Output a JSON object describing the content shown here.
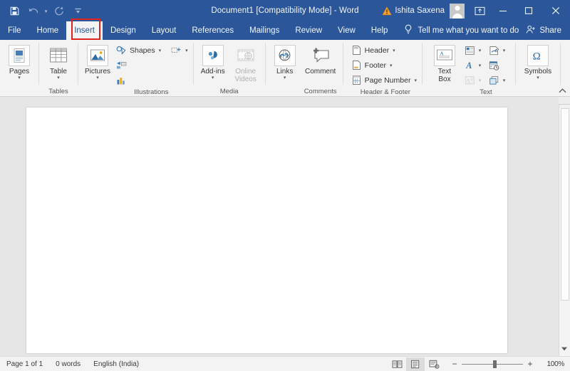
{
  "window": {
    "title": "Document1 [Compatibility Mode]  -  Word",
    "account_name": "Ishita Saxena",
    "quick_access": [
      {
        "name": "save-button",
        "glyph": "save-icon"
      },
      {
        "name": "undo-button",
        "glyph": "undo-icon"
      },
      {
        "name": "redo-button",
        "glyph": "redo-icon"
      },
      {
        "name": "customize-quick-access-button",
        "glyph": "chevron-down-icon"
      }
    ],
    "controls": {
      "ribbon_display_options": "ribbon-display-options-icon",
      "minimize": "minimize-icon",
      "maximize": "maximize-icon",
      "close": "close-icon",
      "warning": "warning-icon"
    }
  },
  "tabs": {
    "items": [
      {
        "label": "File",
        "active": false
      },
      {
        "label": "Home",
        "active": false
      },
      {
        "label": "Insert",
        "active": true
      },
      {
        "label": "Design",
        "active": false
      },
      {
        "label": "Layout",
        "active": false
      },
      {
        "label": "References",
        "active": false
      },
      {
        "label": "Mailings",
        "active": false
      },
      {
        "label": "Review",
        "active": false
      },
      {
        "label": "View",
        "active": false
      },
      {
        "label": "Help",
        "active": false
      }
    ],
    "tell_me": "Tell me what you want to do",
    "share": "Share",
    "highlight_color": "#e0231d",
    "accent_color": "#2b579a"
  },
  "ribbon": {
    "groups": [
      {
        "label": "",
        "big_buttons": [
          {
            "label": "Pages",
            "icon": "pages-icon",
            "dropdown": true,
            "disabled": false
          }
        ]
      },
      {
        "label": "Tables",
        "big_buttons": [
          {
            "label": "Table",
            "icon": "table-icon",
            "dropdown": true,
            "disabled": false
          }
        ]
      },
      {
        "label": "Illustrations",
        "big_buttons": [
          {
            "label": "Pictures",
            "icon": "pictures-icon",
            "dropdown": true,
            "disabled": false
          }
        ],
        "small_buttons": [
          {
            "label": "Shapes",
            "icon": "shapes-icon",
            "dropdown": true,
            "disabled": false
          },
          {
            "label": "",
            "icon": "smartart-icon",
            "dropdown": false,
            "disabled": false
          },
          {
            "label": "",
            "icon": "chart-icon",
            "dropdown": false,
            "disabled": false
          }
        ],
        "extra_buttons": [
          {
            "label": "",
            "icon": "screenshot-icon",
            "dropdown": true,
            "disabled": false
          }
        ]
      },
      {
        "label": "Media",
        "big_buttons": [
          {
            "label": "Add-ins",
            "icon": "addins-icon",
            "dropdown": true,
            "disabled": false
          },
          {
            "label": "Online Videos",
            "icon": "online-video-icon",
            "dropdown": false,
            "disabled": true
          }
        ]
      },
      {
        "label": "Comments",
        "big_buttons": [
          {
            "label": "Links",
            "icon": "links-icon",
            "dropdown": true,
            "disabled": false
          },
          {
            "label": "Comment",
            "icon": "new-comment-icon",
            "dropdown": false,
            "disabled": false
          }
        ]
      },
      {
        "label": "Header & Footer",
        "small_buttons": [
          {
            "label": "Header",
            "icon": "header-icon",
            "dropdown": true,
            "disabled": false
          },
          {
            "label": "Footer",
            "icon": "footer-icon",
            "dropdown": true,
            "disabled": false
          },
          {
            "label": "Page Number",
            "icon": "page-number-icon",
            "dropdown": true,
            "disabled": false
          }
        ]
      },
      {
        "label": "Text",
        "big_buttons": [
          {
            "label": "Text Box",
            "icon": "text-box-icon",
            "dropdown": true,
            "disabled": false
          }
        ],
        "icon_grid": [
          {
            "icon": "quick-parts-icon",
            "dropdown": true,
            "disabled": false
          },
          {
            "icon": "signature-line-icon",
            "dropdown": true,
            "disabled": false
          },
          {
            "icon": "wordart-icon",
            "dropdown": true,
            "disabled": false
          },
          {
            "icon": "date-time-icon",
            "dropdown": false,
            "disabled": false
          },
          {
            "icon": "drop-cap-icon",
            "dropdown": true,
            "disabled": true
          },
          {
            "icon": "object-icon",
            "dropdown": true,
            "disabled": false
          }
        ]
      },
      {
        "label": "",
        "big_buttons": [
          {
            "label": "Symbols",
            "icon": "symbols-omega-icon",
            "dropdown": true,
            "disabled": false
          }
        ]
      }
    ],
    "collapse_label": "collapse-ribbon-icon"
  },
  "document": {
    "page_count": 1,
    "blank": true
  },
  "statusbar": {
    "page_info": "Page 1 of 1",
    "word_count": "0 words",
    "language": "English (India)",
    "views": [
      {
        "name": "read-mode-view-button",
        "icon": "read-mode-icon",
        "selected": false
      },
      {
        "name": "print-layout-view-button",
        "icon": "print-layout-icon",
        "selected": true
      },
      {
        "name": "web-layout-view-button",
        "icon": "web-layout-icon",
        "selected": false
      }
    ],
    "zoom": {
      "minus": "−",
      "plus": "+",
      "value": "100%",
      "position_pct": 50
    }
  }
}
